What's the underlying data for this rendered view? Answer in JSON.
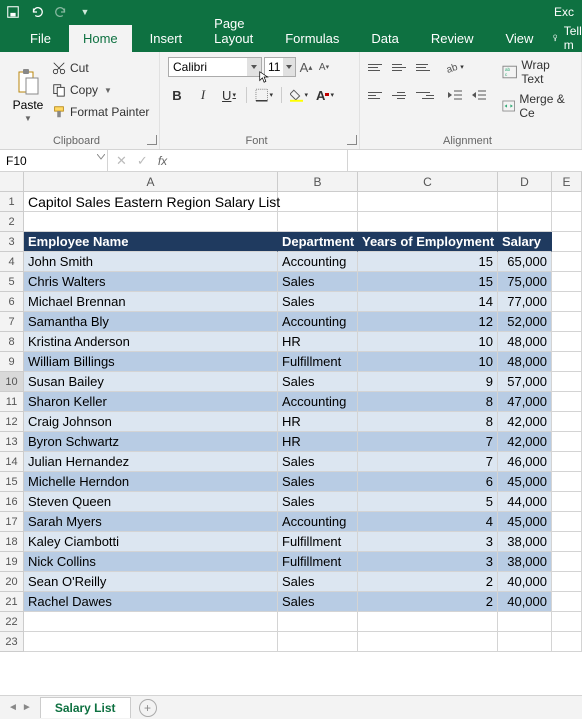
{
  "app": {
    "title": "Exc"
  },
  "qat": {
    "save": "save-icon",
    "undo": "undo-icon",
    "redo": "redo-icon"
  },
  "tabs": {
    "file": "File",
    "home": "Home",
    "insert": "Insert",
    "pagelayout": "Page Layout",
    "formulas": "Formulas",
    "data": "Data",
    "review": "Review",
    "view": "View",
    "tell": "Tell m"
  },
  "clipboard": {
    "paste": "Paste",
    "cut": "Cut",
    "copy": "Copy",
    "fmtpainter": "Format Painter",
    "group": "Clipboard"
  },
  "font": {
    "name": "Calibri",
    "size": "11",
    "group": "Font",
    "bold": "B",
    "italic": "I",
    "underline": "U",
    "growA": "A",
    "shrinkA": "A"
  },
  "alignment": {
    "wrap": "Wrap Text",
    "merge": "Merge & Ce",
    "group": "Alignment"
  },
  "namebox": "F10",
  "columns": {
    "A": "A",
    "B": "B",
    "C": "C",
    "D": "D",
    "E": "E"
  },
  "title": "Capitol Sales Eastern Region Salary List",
  "headers": {
    "name": "Employee Name",
    "dept": "Department",
    "years": "Years of Employment",
    "salary": "Salary"
  },
  "rows": [
    {
      "name": "John Smith",
      "dept": "Accounting",
      "years": "15",
      "salary": "65,000"
    },
    {
      "name": "Chris Walters",
      "dept": "Sales",
      "years": "15",
      "salary": "75,000"
    },
    {
      "name": "Michael Brennan",
      "dept": "Sales",
      "years": "14",
      "salary": "77,000"
    },
    {
      "name": "Samantha Bly",
      "dept": "Accounting",
      "years": "12",
      "salary": "52,000"
    },
    {
      "name": "Kristina Anderson",
      "dept": "HR",
      "years": "10",
      "salary": "48,000"
    },
    {
      "name": "William Billings",
      "dept": "Fulfillment",
      "years": "10",
      "salary": "48,000"
    },
    {
      "name": "Susan Bailey",
      "dept": "Sales",
      "years": "9",
      "salary": "57,000"
    },
    {
      "name": "Sharon Keller",
      "dept": "Accounting",
      "years": "8",
      "salary": "47,000"
    },
    {
      "name": "Craig Johnson",
      "dept": "HR",
      "years": "8",
      "salary": "42,000"
    },
    {
      "name": "Byron Schwartz",
      "dept": "HR",
      "years": "7",
      "salary": "42,000"
    },
    {
      "name": "Julian Hernandez",
      "dept": "Sales",
      "years": "7",
      "salary": "46,000"
    },
    {
      "name": "Michelle Herndon",
      "dept": "Sales",
      "years": "6",
      "salary": "45,000"
    },
    {
      "name": "Steven Queen",
      "dept": "Sales",
      "years": "5",
      "salary": "44,000"
    },
    {
      "name": "Sarah Myers",
      "dept": "Accounting",
      "years": "4",
      "salary": "45,000"
    },
    {
      "name": "Kaley Ciambotti",
      "dept": "Fulfillment",
      "years": "3",
      "salary": "38,000"
    },
    {
      "name": "Nick Collins",
      "dept": "Fulfillment",
      "years": "3",
      "salary": "38,000"
    },
    {
      "name": "Sean O'Reilly",
      "dept": "Sales",
      "years": "2",
      "salary": "40,000"
    },
    {
      "name": "Rachel Dawes",
      "dept": "Sales",
      "years": "2",
      "salary": "40,000"
    }
  ],
  "sheet": {
    "name": "Salary List"
  }
}
